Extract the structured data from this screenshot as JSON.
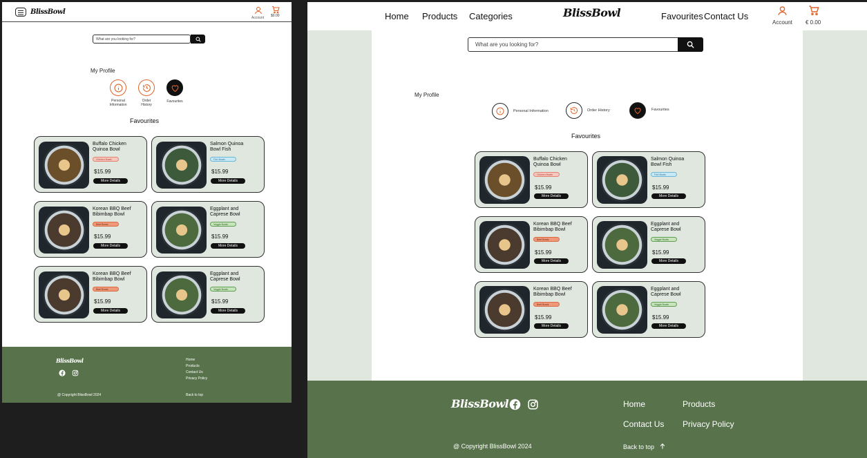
{
  "brand": {
    "logo": "BlissBowl",
    "accent_color": "#e0632a",
    "footer_color": "#58724b",
    "card_color": "#dfe7df"
  },
  "mobile": {
    "account_label": "Account",
    "cart_total": "$0.00",
    "search_placeholder": "What are you looking for?",
    "profile_title": "My Profile",
    "profile_items": [
      {
        "label_line1": "Personal",
        "label_line2": "Information",
        "icon": "info-icon"
      },
      {
        "label_line1": "Order",
        "label_line2": "History",
        "icon": "history-icon"
      },
      {
        "label_line1": "Favourites",
        "label_line2": "",
        "icon": "heart-icon",
        "active": true
      }
    ],
    "favourites_title": "Favourites",
    "footer": {
      "links": [
        "Home",
        "Products",
        "Contact Us",
        "Privacy Policy"
      ],
      "copyright": "@ Copyright BlissBowl 2024",
      "back_to_top": "Back to top"
    }
  },
  "desktop": {
    "nav": [
      "Home",
      "Products",
      "Categories",
      "Favourites",
      "Contact Us"
    ],
    "account_label": "Account",
    "cart_total": "€ 0.00",
    "search_placeholder": "What are you looking for?",
    "profile_title": "My Profile",
    "profile_items": [
      {
        "label": "Personal Information",
        "icon": "info-icon"
      },
      {
        "label": "Order History",
        "icon": "history-icon"
      },
      {
        "label": "Favourites",
        "icon": "heart-icon",
        "active": true
      }
    ],
    "favourites_title": "Favourites",
    "footer": {
      "links": [
        "Home",
        "Products",
        "Contact Us",
        "Privacy Policy"
      ],
      "copyright": "@ Copyright BlissBowl 2024",
      "back_to_top": "Back to top"
    }
  },
  "products": [
    {
      "name_line1": "Buffalo Chicken",
      "name_line2": "Quinoa Bowl",
      "tag": "Chicken Bowls",
      "tag_type": "chicken",
      "price": "$15.99",
      "button": "More Details"
    },
    {
      "name_line1": "Salmon Quinoa",
      "name_line2": "Bowl Fish",
      "tag": "Fish Bowls",
      "tag_type": "fish",
      "price": "$15.99",
      "button": "More Details"
    },
    {
      "name_line1": "Korean BBQ Beef",
      "name_line2": "Bibimbap Bowl",
      "tag": "Beef Bowls",
      "tag_type": "beef",
      "price": "$15.99",
      "button": "More Details"
    },
    {
      "name_line1": "Eggplant and",
      "name_line2": "Caprese Bowl",
      "tag": "Veggie Bowls",
      "tag_type": "veggie",
      "price": "$15.99",
      "button": "More Details"
    },
    {
      "name_line1": "Korean BBQ Beef",
      "name_line2": "Bibimbap Bowl",
      "tag": "Beef Bowls",
      "tag_type": "beef",
      "price": "$15.99",
      "button": "More Details"
    },
    {
      "name_line1": "Eggplant and",
      "name_line2": "Caprese Bowl",
      "tag": "Veggie Bowls",
      "tag_type": "veggie",
      "price": "$15.99",
      "button": "More Details"
    }
  ]
}
